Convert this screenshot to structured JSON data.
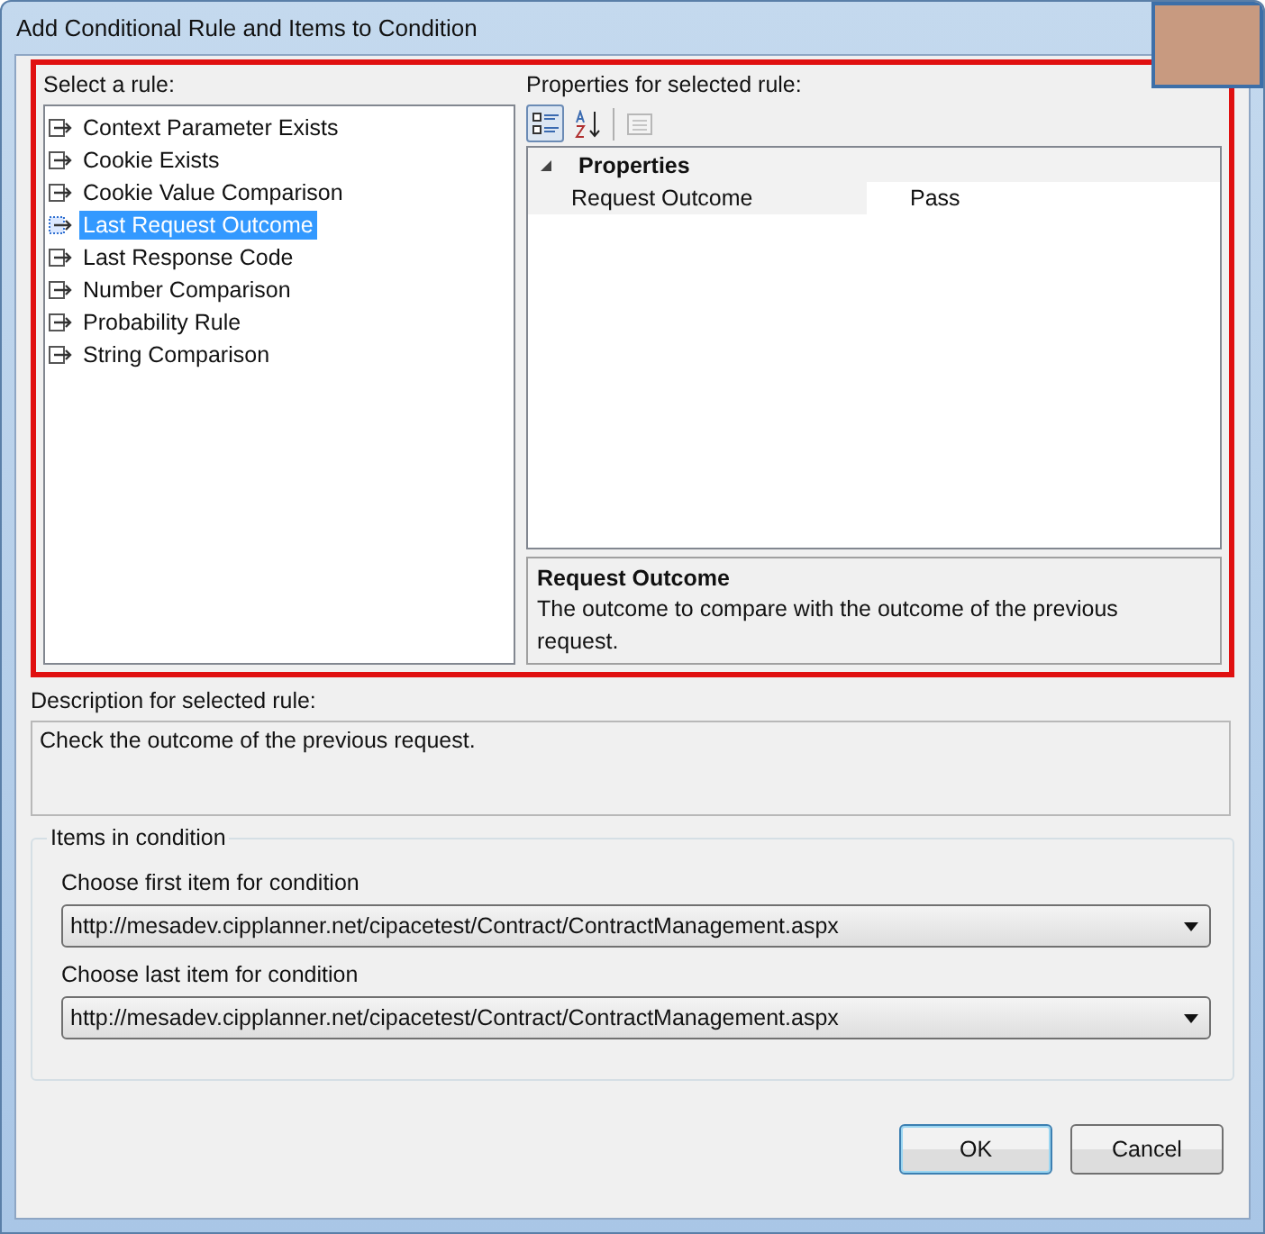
{
  "window": {
    "title": "Add Conditional Rule and Items to Condition"
  },
  "rules": {
    "label": "Select a rule:",
    "items": [
      {
        "label": "Context Parameter Exists",
        "selected": false
      },
      {
        "label": "Cookie Exists",
        "selected": false
      },
      {
        "label": "Cookie Value Comparison",
        "selected": false
      },
      {
        "label": "Last Request Outcome",
        "selected": true
      },
      {
        "label": "Last Response Code",
        "selected": false
      },
      {
        "label": "Number Comparison",
        "selected": false
      },
      {
        "label": "Probability Rule",
        "selected": false
      },
      {
        "label": "String Comparison",
        "selected": false
      }
    ]
  },
  "properties": {
    "label": "Properties for selected rule:",
    "toolbar": [
      {
        "kind": "categorized",
        "selected": true
      },
      {
        "kind": "alphabetical",
        "selected": false
      },
      {
        "kind": "property-pages",
        "selected": false
      }
    ],
    "category": {
      "label": "Properties",
      "expanded": true
    },
    "rows": [
      {
        "name": "Request Outcome",
        "value": "Pass"
      }
    ],
    "help": {
      "title": "Request Outcome",
      "text": "The outcome to compare with the outcome of the previous request."
    }
  },
  "description": {
    "label": "Description for selected rule:",
    "text": "Check the outcome of the previous request."
  },
  "items_in_condition": {
    "title": "Items in condition",
    "fields": [
      {
        "label": "Choose first item for condition",
        "value": "http://mesadev.cipplanner.net/cipacetest/Contract/ContractManagement.aspx"
      },
      {
        "label": "Choose last item for condition",
        "value": "http://mesadev.cipplanner.net/cipacetest/Contract/ContractManagement.aspx"
      }
    ]
  },
  "buttons": [
    {
      "label": "OK",
      "default": true
    },
    {
      "label": "Cancel",
      "default": false
    }
  ]
}
